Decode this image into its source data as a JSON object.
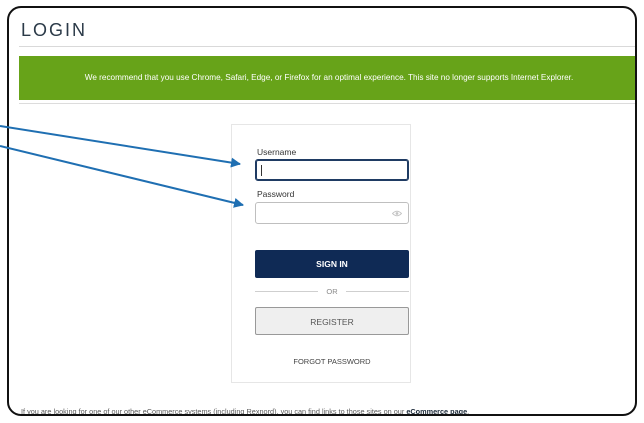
{
  "page": {
    "title": "LOGIN",
    "banner_text": "We recommend that you use Chrome, Safari, Edge, or Firefox for an optimal experience. This site no longer supports Internet Explorer."
  },
  "login_form": {
    "username_label": "Username",
    "username_value": "",
    "password_label": "Password",
    "password_value": "",
    "sign_in_label": "SIGN IN",
    "or_label": "OR",
    "register_label": "REGISTER",
    "forgot_password_label": "FORGOT PASSWORD",
    "password_toggle_icon": "eye-icon"
  },
  "footer": {
    "text_before": "If you are looking for one of our other eCommerce systems (including Rexnord), you can find links to those sites on our ",
    "link_text": "eCommerce page",
    "text_after": "."
  },
  "annotation": {
    "arrow_color": "#1f6fb2"
  },
  "colors": {
    "banner": "#67a319",
    "sign_in_button": "#0f2a55",
    "frame_border": "#111111"
  }
}
